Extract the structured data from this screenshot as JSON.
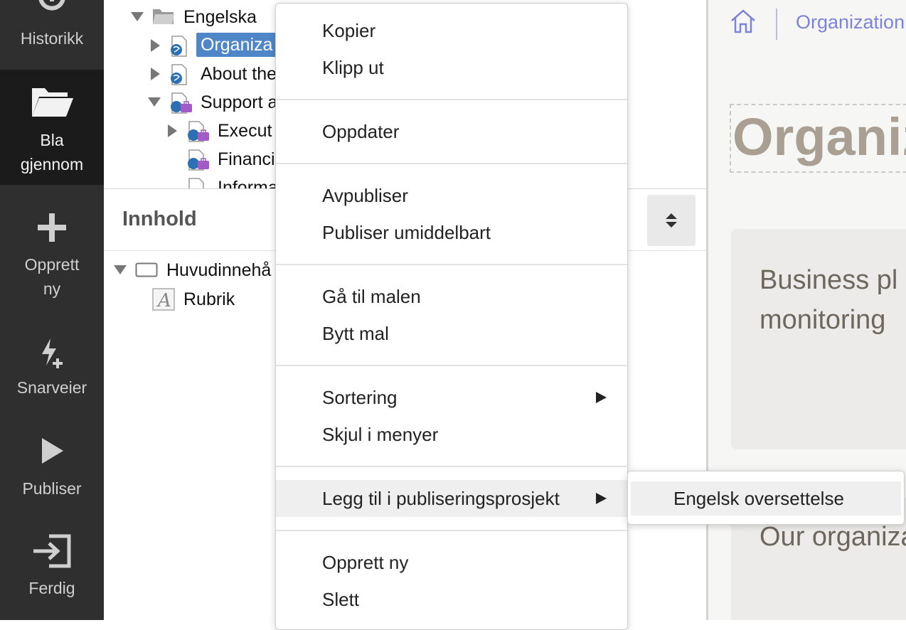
{
  "sidebar": {
    "items": [
      {
        "label": "Historikk",
        "icon": "history-icon"
      },
      {
        "label": "Bla gjennom",
        "label_line1": "Bla",
        "label_line2": "gjennom",
        "icon": "folder-open-icon",
        "active": true
      },
      {
        "label": "Opprett ny",
        "label_line1": "Opprett",
        "label_line2": "ny",
        "icon": "plus-icon"
      },
      {
        "label": "Snarveier",
        "icon": "lightning-plus-icon"
      },
      {
        "label": "Publiser",
        "icon": "play-icon"
      },
      {
        "label": "Ferdig",
        "icon": "exit-icon"
      }
    ]
  },
  "tree": {
    "rows": [
      {
        "label": "Engelska",
        "icon": "folder-icon",
        "expanded": true
      },
      {
        "label": "Organiza",
        "icon": "page-globe-icon",
        "selected": true
      },
      {
        "label": "About the",
        "icon": "page-globe-icon"
      },
      {
        "label": "Support a",
        "icon": "page-globe-briefcase-icon",
        "expanded": true
      },
      {
        "label": "Execut",
        "icon": "page-globe-briefcase-icon"
      },
      {
        "label": "Financi",
        "icon": "page-globe-briefcase-icon"
      },
      {
        "label": "Informa",
        "icon": "page-globe-briefcase-icon"
      }
    ]
  },
  "content": {
    "title": "Innhold",
    "rows": [
      {
        "label": "Huvudinnehå",
        "icon": "container-icon"
      },
      {
        "label": "Rubrik",
        "icon": "text-field-icon"
      }
    ]
  },
  "preview": {
    "breadcrumb": "Organization",
    "heading": "Organization",
    "card1_line1": "Business pl",
    "card1_line2": "monitoring",
    "card2_text": "Our organiza"
  },
  "context_menu": {
    "items": {
      "copy": "Kopier",
      "cut": "Klipp ut",
      "refresh": "Oppdater",
      "unpublish": "Avpubliser",
      "publish_now": "Publiser umiddelbart",
      "goto_template": "Gå til malen",
      "change_template": "Bytt mal",
      "sorting": "Sortering",
      "hide_in_menus": "Skjul i menyer",
      "add_to_project": "Legg til i publiseringsprosjekt",
      "create_new": "Opprett ny",
      "delete": "Slett"
    },
    "submenu": {
      "english_translation": "Engelsk oversettelse"
    }
  },
  "colors": {
    "sidebar_bg": "#2f2f2f",
    "selection": "#4f86c8",
    "breadcrumb": "#7d84d8",
    "heading": "#a99f92"
  }
}
